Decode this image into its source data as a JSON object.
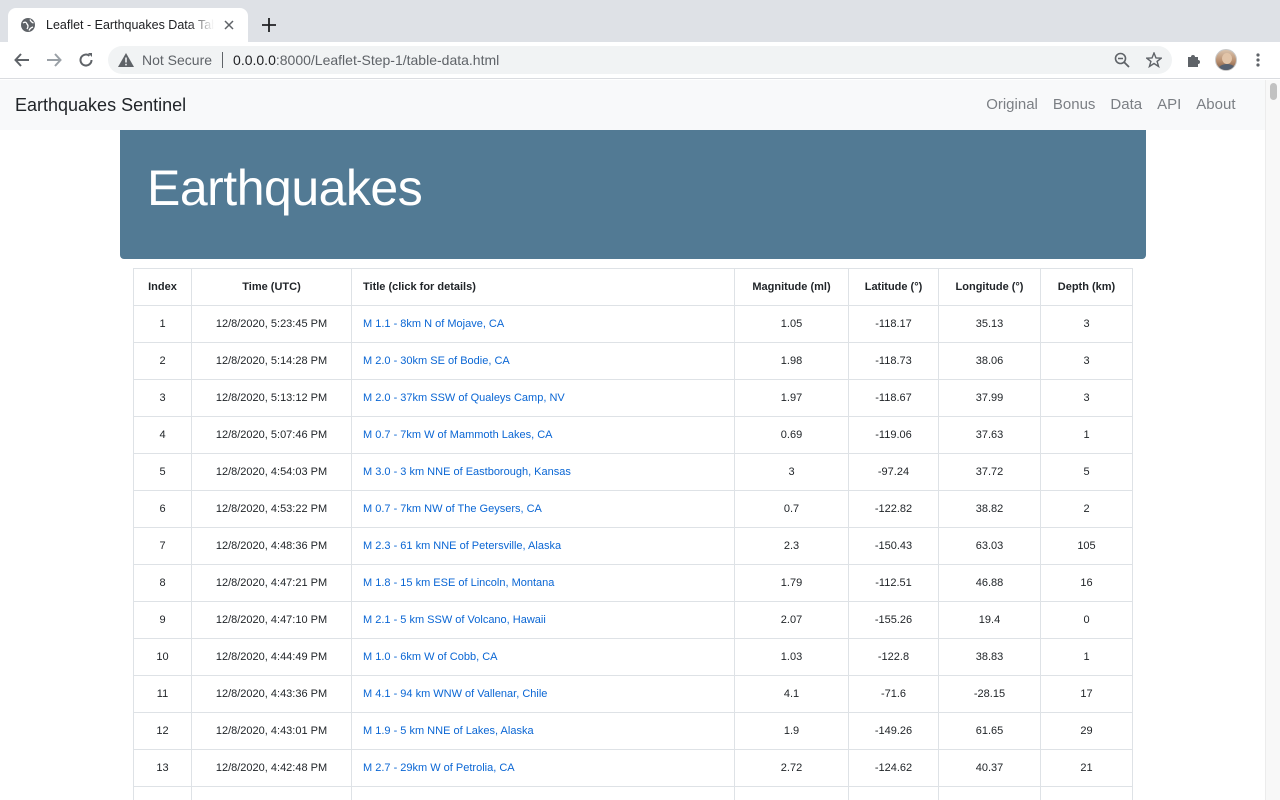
{
  "browser": {
    "tab_title": "Leaflet - Earthquakes Data Table",
    "security_label": "Not Secure",
    "url_host": "0.0.0.0",
    "url_rest": ":8000/Leaflet-Step-1/table-data.html"
  },
  "navbar": {
    "brand": "Earthquakes Sentinel",
    "links": [
      "Original",
      "Bonus",
      "Data",
      "API",
      "About"
    ]
  },
  "jumbotron": {
    "title": "Earthquakes"
  },
  "table": {
    "headers": [
      "Index",
      "Time (UTC)",
      "Title (click for details)",
      "Magnitude (ml)",
      "Latitude (°)",
      "Longitude (°)",
      "Depth (km)"
    ],
    "rows": [
      [
        "1",
        "12/8/2020, 5:23:45 PM",
        "M 1.1 - 8km N of Mojave, CA",
        "1.05",
        "-118.17",
        "35.13",
        "3"
      ],
      [
        "2",
        "12/8/2020, 5:14:28 PM",
        "M 2.0 - 30km SE of Bodie, CA",
        "1.98",
        "-118.73",
        "38.06",
        "3"
      ],
      [
        "3",
        "12/8/2020, 5:13:12 PM",
        "M 2.0 - 37km SSW of Qualeys Camp, NV",
        "1.97",
        "-118.67",
        "37.99",
        "3"
      ],
      [
        "4",
        "12/8/2020, 5:07:46 PM",
        "M 0.7 - 7km W of Mammoth Lakes, CA",
        "0.69",
        "-119.06",
        "37.63",
        "1"
      ],
      [
        "5",
        "12/8/2020, 4:54:03 PM",
        "M 3.0 - 3 km NNE of Eastborough, Kansas",
        "3",
        "-97.24",
        "37.72",
        "5"
      ],
      [
        "6",
        "12/8/2020, 4:53:22 PM",
        "M 0.7 - 7km NW of The Geysers, CA",
        "0.7",
        "-122.82",
        "38.82",
        "2"
      ],
      [
        "7",
        "12/8/2020, 4:48:36 PM",
        "M 2.3 - 61 km NNE of Petersville, Alaska",
        "2.3",
        "-150.43",
        "63.03",
        "105"
      ],
      [
        "8",
        "12/8/2020, 4:47:21 PM",
        "M 1.8 - 15 km ESE of Lincoln, Montana",
        "1.79",
        "-112.51",
        "46.88",
        "16"
      ],
      [
        "9",
        "12/8/2020, 4:47:10 PM",
        "M 2.1 - 5 km SSW of Volcano, Hawaii",
        "2.07",
        "-155.26",
        "19.4",
        "0"
      ],
      [
        "10",
        "12/8/2020, 4:44:49 PM",
        "M 1.0 - 6km W of Cobb, CA",
        "1.03",
        "-122.8",
        "38.83",
        "1"
      ],
      [
        "11",
        "12/8/2020, 4:43:36 PM",
        "M 4.1 - 94 km WNW of Vallenar, Chile",
        "4.1",
        "-71.6",
        "-28.15",
        "17"
      ],
      [
        "12",
        "12/8/2020, 4:43:01 PM",
        "M 1.9 - 5 km NNE of Lakes, Alaska",
        "1.9",
        "-149.26",
        "61.65",
        "29"
      ],
      [
        "13",
        "12/8/2020, 4:42:48 PM",
        "M 2.7 - 29km W of Petrolia, CA",
        "2.72",
        "-124.62",
        "40.37",
        "21"
      ]
    ]
  },
  "colors": {
    "jumbotron_bg": "#527a94",
    "link": "#0a66d4",
    "navbar_bg": "#f8f9fa"
  }
}
